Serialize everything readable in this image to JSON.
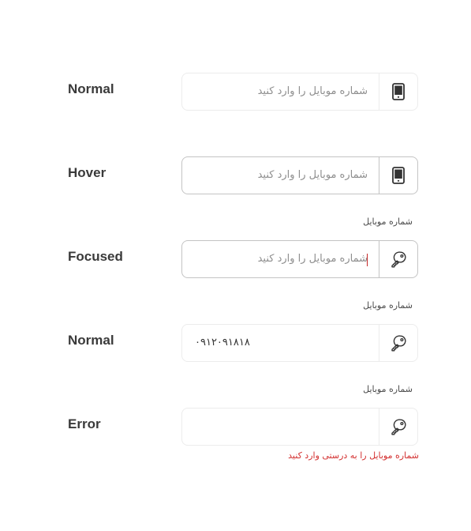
{
  "rows": [
    {
      "label": "Normal",
      "state": "normal",
      "caption": "",
      "placeholder": "شماره موبایل را وارد کنید",
      "value": "",
      "icon": "mobile-icon"
    },
    {
      "label": "Hover",
      "state": "hover",
      "caption": "",
      "placeholder": "شماره موبایل را وارد کنید",
      "value": "",
      "icon": "mobile-icon"
    },
    {
      "label": "Focused",
      "state": "focused",
      "caption": "شماره موبایل",
      "placeholder": "شماره موبایل را وارد کنید",
      "value": "",
      "icon": "key-icon"
    },
    {
      "label": "Normal",
      "state": "filled",
      "caption": "شماره موبایل",
      "placeholder": "",
      "value": "۰۹۱۲۰۹۱۸۱۸",
      "icon": "key-icon"
    },
    {
      "label": "Error",
      "state": "error",
      "caption": "شماره موبایل",
      "placeholder": "",
      "value": "",
      "icon": "key-icon",
      "error_message": "شماره موبایل را به درستی وارد کنید"
    }
  ],
  "colors": {
    "border_default": "#ececec",
    "border_active": "#c4c4c4",
    "error": "#d32f2f",
    "caret": "#c62828"
  }
}
